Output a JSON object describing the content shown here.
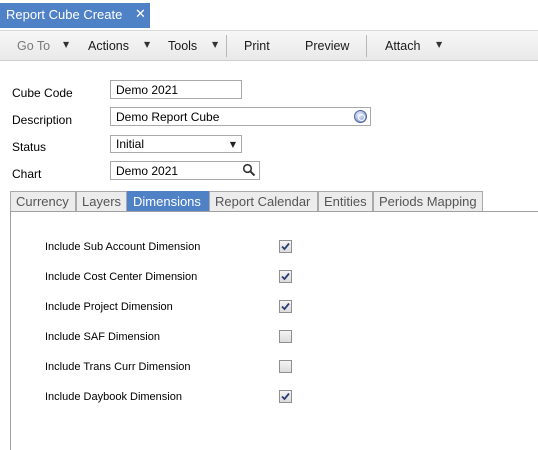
{
  "window": {
    "tab_title": "Report Cube Create",
    "close_glyph": "✕"
  },
  "toolbar": {
    "goto_label": "Go To",
    "actions_label": "Actions",
    "tools_label": "Tools",
    "print_label": "Print",
    "preview_label": "Preview",
    "attach_label": "Attach",
    "arrow_glyph": "▼"
  },
  "form": {
    "cube_code": {
      "label": "Cube Code",
      "value": "Demo 2021"
    },
    "description": {
      "label": "Description",
      "value": "Demo Report Cube"
    },
    "status": {
      "label": "Status",
      "value": "Initial"
    },
    "chart": {
      "label": "Chart",
      "value": "Demo 2021"
    }
  },
  "tabs": [
    {
      "label": "Currency",
      "active": false
    },
    {
      "label": "Layers",
      "active": false
    },
    {
      "label": "Dimensions",
      "active": true
    },
    {
      "label": "Report Calendar",
      "active": false
    },
    {
      "label": "Entities",
      "active": false
    },
    {
      "label": "Periods Mapping",
      "active": false
    }
  ],
  "dimensions": [
    {
      "label": "Include Sub Account Dimension",
      "checked": true
    },
    {
      "label": "Include Cost Center Dimension",
      "checked": true
    },
    {
      "label": "Include Project Dimension",
      "checked": true
    },
    {
      "label": "Include SAF Dimension",
      "checked": false
    },
    {
      "label": "Include Trans Curr Dimension",
      "checked": false
    },
    {
      "label": "Include Daybook Dimension",
      "checked": true
    }
  ],
  "colors": {
    "accent": "#4f81c7",
    "check": "#2b3f73"
  }
}
